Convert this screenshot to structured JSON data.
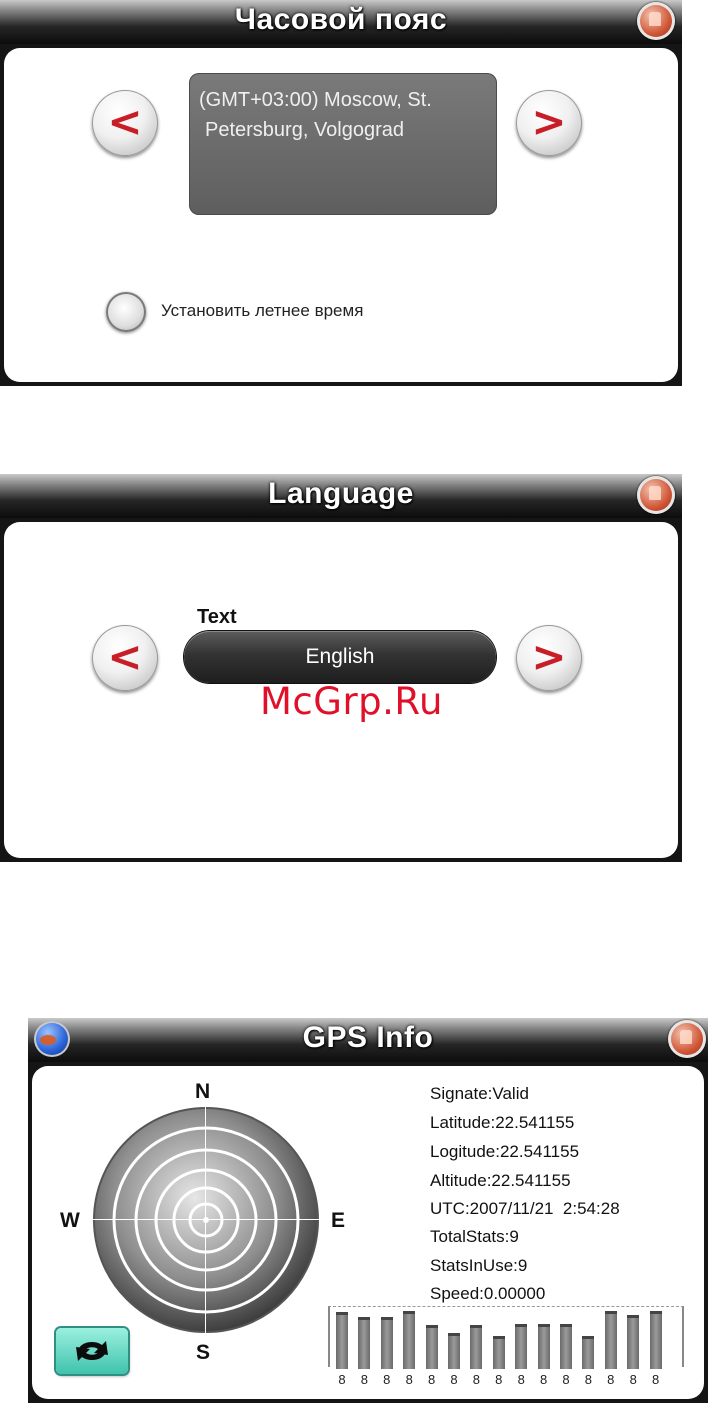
{
  "timezone_screen": {
    "title": "Часовой пояс",
    "zone_line1": "(GMT+03:00) Moscow, St.",
    "zone_line2": "Petersburg, Volgograd",
    "prev_label": "<",
    "next_label": ">",
    "dst_label": "Установить летнее время",
    "dst_checked": false
  },
  "language_screen": {
    "title": "Language",
    "field_label": "Text",
    "selected_language": "English",
    "prev_label": "<",
    "next_label": ">"
  },
  "watermark": "McGrp.Ru",
  "gps_screen": {
    "title": "GPS Info",
    "compass": {
      "north": "N",
      "south": "S",
      "east": "E",
      "west": "W"
    },
    "info": [
      "Signate:Valid",
      "Latitude:22.541155",
      "Logitude:22.541155",
      "Altitude:22.541155",
      "UTC:2007/11/21  2:54:28",
      "TotalStats:9",
      "StatsInUse:9",
      "Speed:0.00000"
    ],
    "satellite_signal_levels": [
      0.9,
      0.82,
      0.82,
      0.92,
      0.68,
      0.55,
      0.68,
      0.5,
      0.7,
      0.7,
      0.7,
      0.5,
      0.92,
      0.85,
      0.92
    ],
    "satellite_labels": [
      "8",
      "8",
      "8",
      "8",
      "8",
      "8",
      "8",
      "8",
      "8",
      "8",
      "8",
      "8",
      "8",
      "8",
      "8"
    ],
    "colors": {
      "refresh_button": "#4fd2bb",
      "home_button": "#cf5535",
      "globe": "#2a63d8"
    }
  },
  "icons": [
    "home-icon",
    "chevron-left-icon",
    "chevron-right-icon",
    "globe-icon",
    "refresh-icon",
    "radio-icon"
  ]
}
